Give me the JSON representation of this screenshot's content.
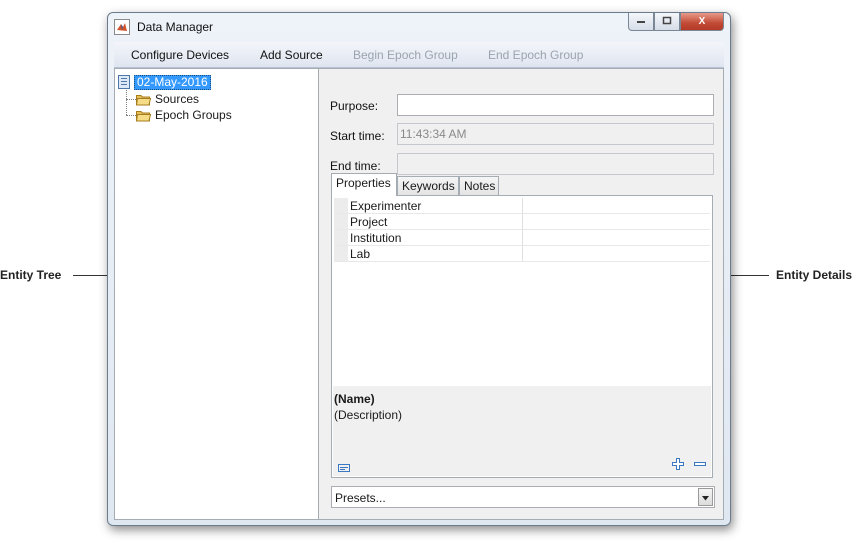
{
  "window": {
    "title": "Data Manager",
    "app_icon": "matlab-icon"
  },
  "window_controls": {
    "minimize_icon": "minimize-icon",
    "maximize_icon": "maximize-icon",
    "close_icon": "close-icon",
    "close_glyph": "X"
  },
  "menu": {
    "configure_devices": "Configure Devices",
    "add_source": "Add Source",
    "begin_epoch_group": "Begin Epoch Group",
    "end_epoch_group": "End Epoch Group"
  },
  "tree": {
    "root": "02-May-2016",
    "children": [
      "Sources",
      "Epoch Groups"
    ]
  },
  "details": {
    "purpose_label": "Purpose:",
    "purpose_value": "",
    "start_time_label": "Start time:",
    "start_time_value": "11:43:34 AM",
    "end_time_label": "End time:",
    "end_time_value": ""
  },
  "tabs": [
    "Properties",
    "Keywords",
    "Notes"
  ],
  "properties": {
    "rows": [
      {
        "name": "Experimenter",
        "value": ""
      },
      {
        "name": "Project",
        "value": ""
      },
      {
        "name": "Institution",
        "value": ""
      },
      {
        "name": "Lab",
        "value": ""
      }
    ],
    "description_name": "(Name)",
    "description_text": "(Description)"
  },
  "presets": {
    "selected": "Presets..."
  },
  "callouts": {
    "left": "Entity Tree",
    "right": "Entity Details"
  },
  "colors": {
    "selection": "#3399ff",
    "close_button": "#c24a35",
    "disabled_text": "#9ba3ad",
    "add_icon": "#3a78c4"
  }
}
